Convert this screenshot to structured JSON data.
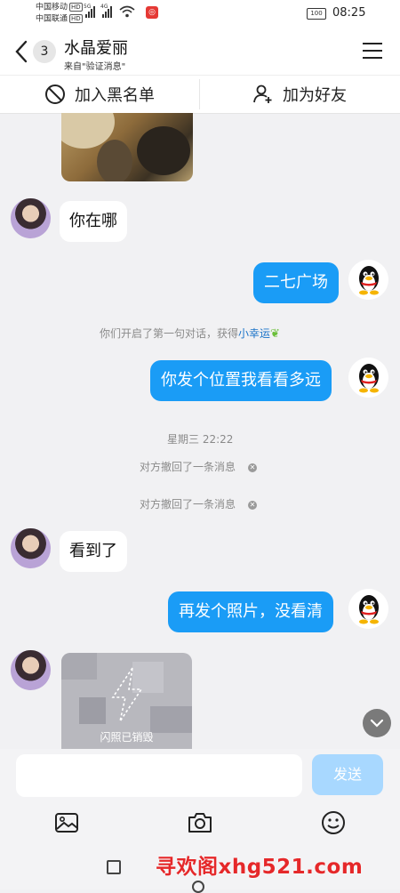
{
  "status_bar": {
    "carrier1": "中国移动",
    "carrier2": "中国联通",
    "hd_tag": "HD",
    "net1": "5G",
    "net2": "4G",
    "battery": "100",
    "time": "08:25"
  },
  "header": {
    "unread_count": "3",
    "title": "水晶爱丽",
    "subtitle": "来自\"验证消息\""
  },
  "action_bar": {
    "block_label": "加入黑名单",
    "add_friend_label": "加为好友"
  },
  "messages": {
    "m1": "你在哪",
    "m2": "二七广场",
    "sys1_prefix": "你们开启了第一句对话，获得",
    "sys1_link": "小幸运",
    "m3": "你发个位置我看看多远",
    "timestamp": "星期三 22:22",
    "recall1": "对方撤回了一条消息",
    "recall2": "对方撤回了一条消息",
    "m4": "看到了",
    "m5": "再发个照片，没看清",
    "flash_label": "闪照已销毁"
  },
  "composer": {
    "placeholder": "",
    "send_label": "发送"
  },
  "watermark": "寻欢阁xhg521.com",
  "colors": {
    "accent": "#1a9cf6",
    "send_disabled": "#a8d8ff",
    "link": "#1a73c8",
    "watermark": "#e5282a"
  }
}
